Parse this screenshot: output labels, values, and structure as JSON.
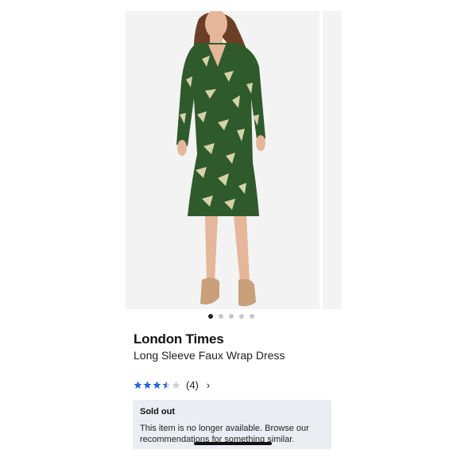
{
  "product": {
    "brand": "London Times",
    "title": "Long Sleeve Faux Wrap Dress",
    "image_icon": "dress-photo",
    "gallery_count": 5,
    "gallery_active_index": 0,
    "rating_value": 3.5,
    "rating_max": 5,
    "review_count": "(4)",
    "chevron": "›"
  },
  "notice": {
    "title": "Sold out",
    "body": "This item is no longer available. Browse our recommendations for something similar."
  },
  "colors": {
    "star_filled": "#2266d9",
    "star_empty": "#cfcfcf",
    "dress_green": "#2f5a2b",
    "dress_cream": "#e7dfb8"
  }
}
